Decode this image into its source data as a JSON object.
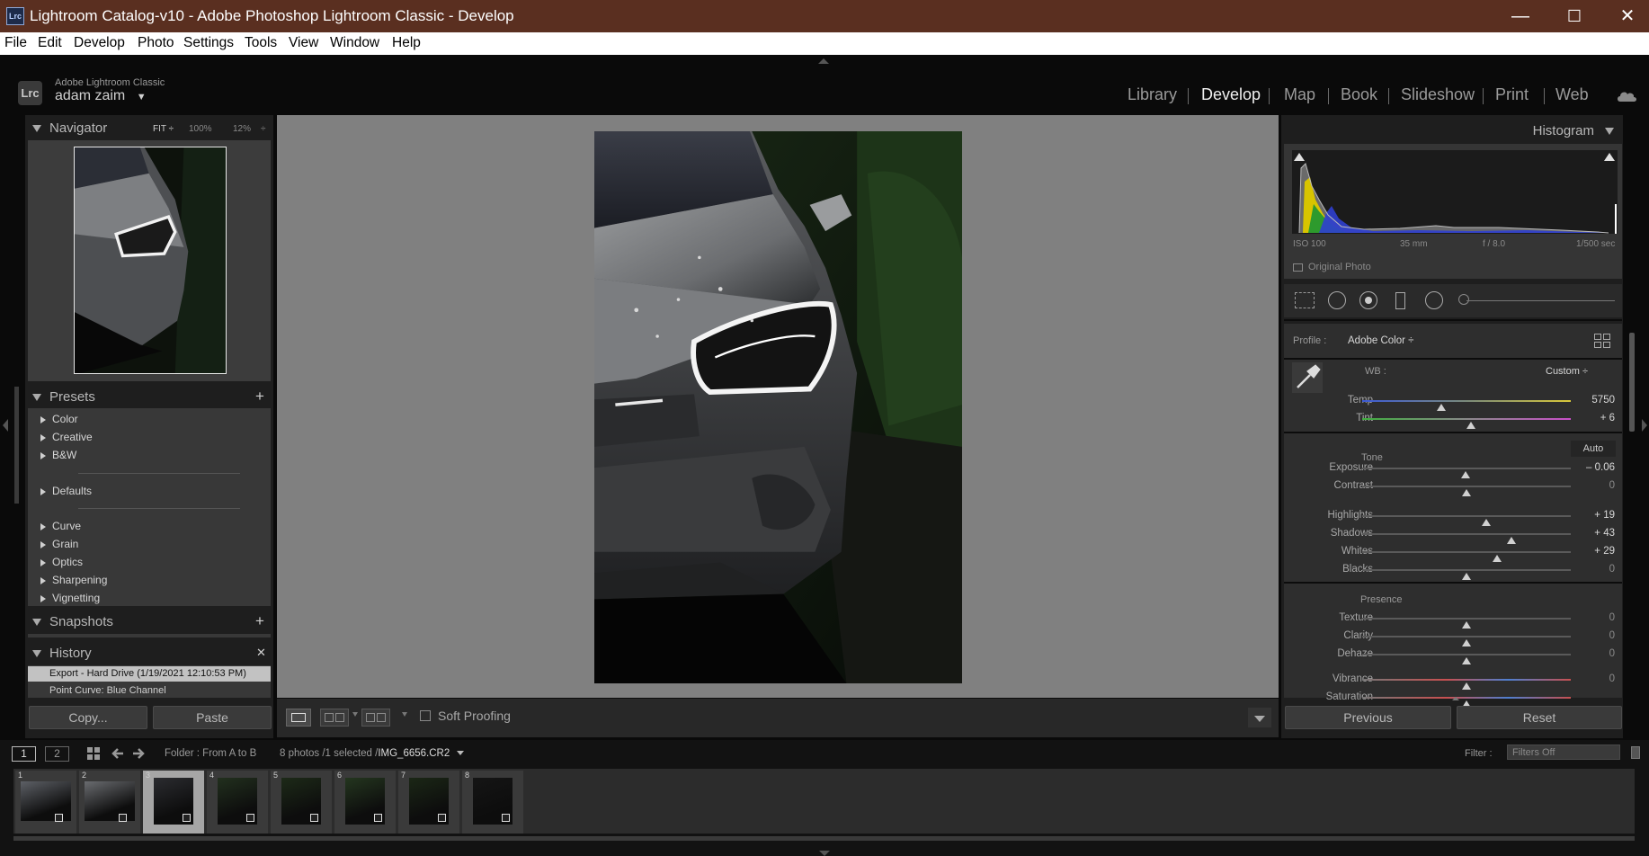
{
  "window": {
    "app_icon_text": "Lrc",
    "title": "Lightroom Catalog-v10 - Adobe Photoshop Lightroom Classic - Develop",
    "minimize_glyph": "—",
    "maximize_glyph": "☐",
    "close_glyph": "✕"
  },
  "menu": [
    "File",
    "Edit",
    "Develop",
    "Photo",
    "Settings",
    "Tools",
    "View",
    "Window",
    "Help"
  ],
  "identity": {
    "badge": "Lrc",
    "product": "Adobe Lightroom Classic",
    "user": "adam zaim",
    "user_arrow": "▼"
  },
  "modules": [
    "Library",
    "Develop",
    "Map",
    "Book",
    "Slideshow",
    "Print",
    "Web"
  ],
  "active_module": "Develop",
  "navigator": {
    "title": "Navigator",
    "zoom_fit": "FIT ÷",
    "zoom_100": "100%",
    "zoom_12": "12%",
    "zoom_arrows": "÷"
  },
  "presets": {
    "title": "Presets",
    "add": "+",
    "groups_a": [
      "Color",
      "Creative",
      "B&W"
    ],
    "groups_b": [
      "Defaults"
    ],
    "groups_c": [
      "Curve",
      "Grain",
      "Optics",
      "Sharpening",
      "Vignetting"
    ]
  },
  "snapshots": {
    "title": "Snapshots",
    "add": "+"
  },
  "history": {
    "title": "History",
    "clear": "✕",
    "items": [
      "Export - Hard Drive (1/19/2021 12:10:53 PM)",
      "Point Curve: Blue Channel"
    ]
  },
  "left_buttons": {
    "copy": "Copy...",
    "paste": "Paste"
  },
  "toolbar": {
    "soft_proofing": "Soft Proofing"
  },
  "histogram": {
    "title": "Histogram",
    "iso": "ISO 100",
    "focal": "35 mm",
    "aperture": "f / 8.0",
    "shutter": "1/500 sec",
    "original_photo": "Original Photo"
  },
  "basic": {
    "profile_label": "Profile :",
    "profile_value": "Adobe Color ÷",
    "wb_label": "WB :",
    "wb_value": "Custom ÷",
    "tone_label": "Tone",
    "auto": "Auto",
    "presence_label": "Presence",
    "sliders": [
      {
        "label": "Temp",
        "value": "5750",
        "pos": 0.38
      },
      {
        "label": "Tint",
        "value": "+ 6",
        "pos": 0.52
      },
      {
        "label": "Exposure",
        "value": "– 0.06",
        "pos": 0.495
      },
      {
        "label": "Contrast",
        "value": "0",
        "pos": 0.5
      },
      {
        "label": "Highlights",
        "value": "+ 19",
        "pos": 0.595
      },
      {
        "label": "Shadows",
        "value": "+ 43",
        "pos": 0.715
      },
      {
        "label": "Whites",
        "value": "+ 29",
        "pos": 0.645
      },
      {
        "label": "Blacks",
        "value": "0",
        "pos": 0.5
      },
      {
        "label": "Texture",
        "value": "0",
        "pos": 0.5
      },
      {
        "label": "Clarity",
        "value": "0",
        "pos": 0.5
      },
      {
        "label": "Dehaze",
        "value": "0",
        "pos": 0.5
      },
      {
        "label": "Vibrance",
        "value": "0",
        "pos": 0.5
      },
      {
        "label": "Saturation",
        "value": "",
        "pos": 0.5
      }
    ]
  },
  "right_buttons": {
    "previous": "Previous",
    "reset": "Reset"
  },
  "filmstrip": {
    "view1": "1",
    "view2": "2",
    "source": "Folder : From A to B",
    "count": "8 photos /1 selected /",
    "filename": "IMG_6656.CR2",
    "filter_label": "Filter :",
    "filter_value": "Filters Off",
    "thumbs": [
      "1",
      "2",
      "3",
      "4",
      "5",
      "6",
      "7",
      "8"
    ],
    "selected": "3"
  },
  "colors": {
    "title_bar": "#5a2f20",
    "panel": "#1e1e1e",
    "canvas": "#808080"
  }
}
